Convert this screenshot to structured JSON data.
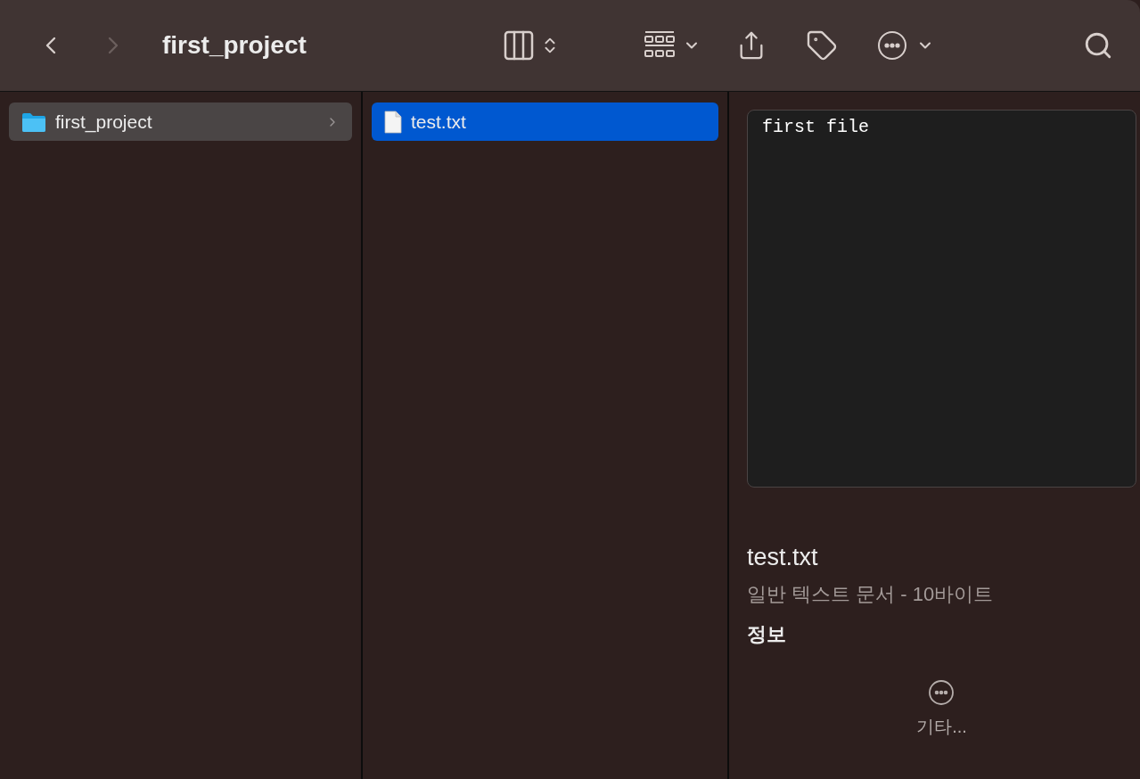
{
  "window": {
    "title": "first_project"
  },
  "toolbar": {
    "back_disabled": false,
    "forward_disabled": true
  },
  "columns": [
    {
      "active": false,
      "items": [
        {
          "name": "first_project",
          "kind": "folder",
          "selected": true,
          "has_children": true
        }
      ]
    },
    {
      "active": true,
      "items": [
        {
          "name": "test.txt",
          "kind": "file",
          "selected": true,
          "has_children": false
        }
      ]
    }
  ],
  "preview": {
    "content": "first file",
    "name": "test.txt",
    "subtitle": "일반 텍스트 문서 - 10바이트",
    "section": "정보",
    "more_label": "기타..."
  }
}
